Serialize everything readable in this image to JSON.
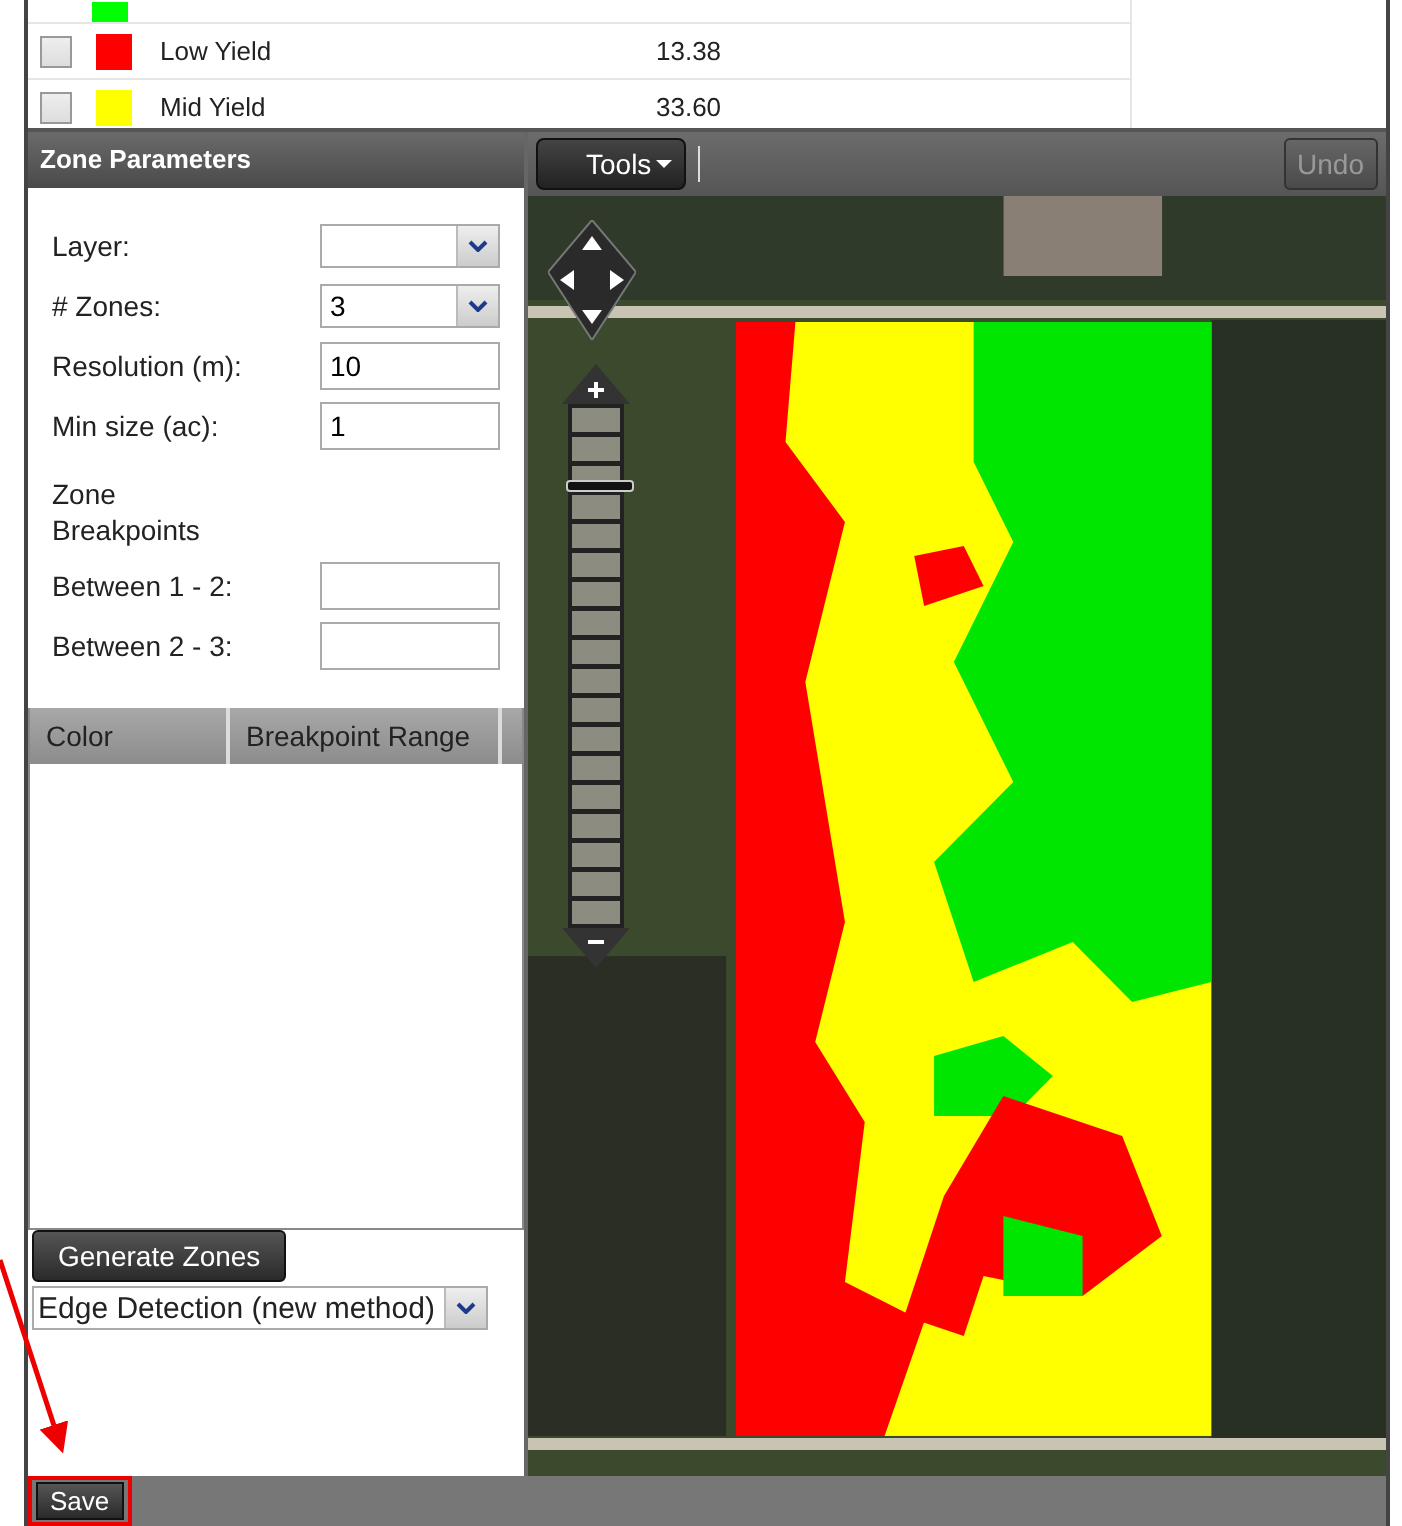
{
  "legend": {
    "rows": [
      {
        "color": "#00ff00"
      },
      {
        "checked": false,
        "color": "#ff0000",
        "label": "Low Yield",
        "value": "13.38"
      },
      {
        "checked": false,
        "color": "#ffff00",
        "label": "Mid Yield",
        "value": "33.60"
      }
    ]
  },
  "panel": {
    "title": "Zone Parameters",
    "fields": [
      {
        "kind": "select",
        "label": "Layer:"
      },
      {
        "kind": "select",
        "label": "# Zones:",
        "value": "3"
      },
      {
        "kind": "text",
        "label": "Resolution (m):",
        "value": "10"
      },
      {
        "kind": "text",
        "label": "Min size (ac):",
        "value": "1"
      }
    ],
    "section_label": "Zone Breakpoints",
    "breakpoints": [
      {
        "label": "Between 1 - 2:"
      },
      {
        "label": "Between 2 - 3:"
      }
    ],
    "table": {
      "columns": [
        "Color",
        "Breakpoint Range"
      ]
    },
    "generate_button": "Generate Zones",
    "method": {
      "value": "Edge Detection (new method)"
    }
  },
  "map": {
    "tools": "Tools",
    "undo": {
      "label": "Undo",
      "disabled": true
    },
    "zoom": {
      "level": 0.86
    }
  },
  "footer": {
    "save": "Save"
  }
}
